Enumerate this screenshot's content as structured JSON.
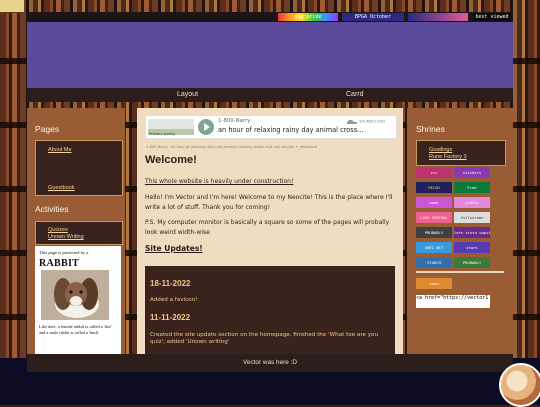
{
  "nav": {
    "layout": "Layout",
    "carrd": "Carrd"
  },
  "topbar_buttons": [
    {
      "label": "gay pride",
      "color": "#b32b8c"
    },
    {
      "label": "BPGA October",
      "color": "#2c2a80"
    },
    {
      "label": "best viewed",
      "color": "#0a0a0a"
    }
  ],
  "left": {
    "pages_title": "Pages",
    "pages_links": [
      "About Me",
      "Guestbook"
    ],
    "activities_title": "Activities",
    "activities_links": [
      "Quizzes",
      "Unown Writing"
    ],
    "rabbit": {
      "line1": "This page is protected by a",
      "line2": "RABBIT",
      "line3": "Like deer, a female rabbit is called a 'doe' and a male rabbit is called a 'buck'"
    }
  },
  "player": {
    "title": "1-800-Narry",
    "subtitle": "an hour of relaxing rainy day animal cross...",
    "privacy": "Privacy policy",
    "brand": "SOUNDCLOUD",
    "footer_text": "1-800-Narry · an hour of relaxing rainy day animal crossing music and rain sounds + ambience"
  },
  "main": {
    "title": "Welcome!",
    "construction": "This whole website is heavily under construction!",
    "intro": "Hello! I'm Vector and I'm here! Welcome to my Neocite! This is the place where I'll write a lot of stuff. Thank you for coming!",
    "ps": "P.S. My computer monitor is basically a square so some of the pages will probally look weird width-wise",
    "updates_title": "Site Updates!",
    "updates": [
      {
        "date": "18-11-2022",
        "text": "Added a favicon!"
      },
      {
        "date": "11-11-2022",
        "text": "Created the site update section on the homepage, finished the 'What toe are you quiz', added 'Unown writing'"
      }
    ]
  },
  "right": {
    "shrines_title": "Shrines",
    "shrines_links": [
      "Goatlings",
      "Rune Factory 3"
    ],
    "buttons": [
      {
        "label": "ccc",
        "color": "#c03070"
      },
      {
        "label": "stickers",
        "color": "#8a3ab0"
      },
      {
        "label": "MELON",
        "color": "#202060"
      },
      {
        "label": "Free",
        "color": "#0a7a3a"
      },
      {
        "label": "oooo",
        "color": "#cc55d8"
      },
      {
        "label": "pretty",
        "color": "#e38ae0"
      },
      {
        "label": "LOVE CENTRAL",
        "color": "#f06090"
      },
      {
        "label": "fullscreen",
        "color": "#dddddd"
      },
      {
        "label": "PROBABLY",
        "color": "#404040"
      },
      {
        "label": "lets crush capitalism",
        "color": "#6a2a8a"
      },
      {
        "label": "ANTI NFT",
        "color": "#3a9ae0"
      },
      {
        "label": "stars",
        "color": "#5a3ab0"
      },
      {
        "label": "STARCH",
        "color": "#3070b0"
      },
      {
        "label": "PROBABLY",
        "color": "#3a7a3a"
      },
      {
        "label": "snow",
        "color": "#e08a30"
      }
    ],
    "code_snippet": "<a href=\"https://vector1"
  },
  "footer": {
    "text": "Vector was here :D"
  }
}
